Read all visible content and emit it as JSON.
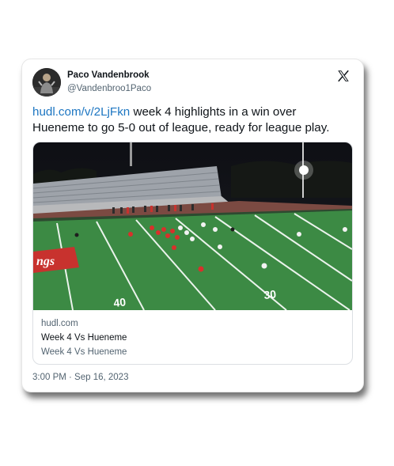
{
  "author": {
    "name": "Paco Vandenbrook",
    "handle": "@Vandenbroo1Paco"
  },
  "platform_icon": "x-logo-icon",
  "tweet": {
    "link_text": "hudl.com/v/2LjFkn",
    "body_text": " week 4 highlights in a win over Hueneme to go 5-0 out of league, ready for league play."
  },
  "link_card": {
    "domain": "hudl.com",
    "title": "Week 4 Vs Hueneme",
    "description": "Week 4 Vs Hueneme",
    "thumbnail_icon": "football-field-image",
    "field_numbers": [
      "40",
      "30"
    ]
  },
  "timestamp": "3:00 PM · Sep 16, 2023",
  "colors": {
    "link": "#1d76c2",
    "text": "#0f1419",
    "secondary": "#536471",
    "field": "#3c8a44"
  }
}
